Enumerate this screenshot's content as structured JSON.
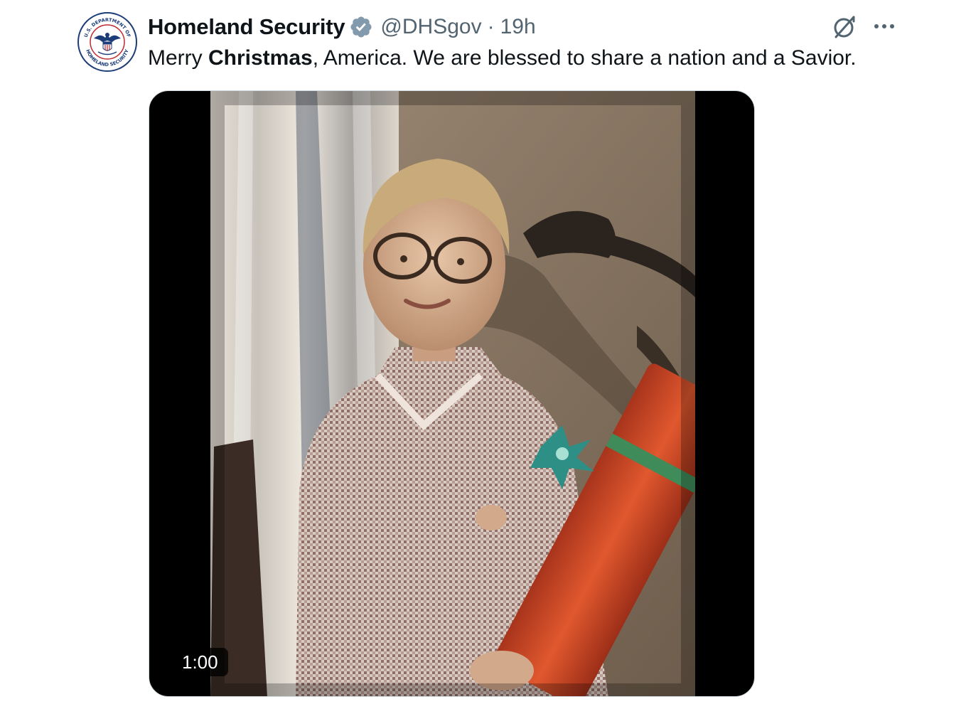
{
  "tweet": {
    "author": {
      "display_name": "Homeland Security",
      "handle": "@DHSgov",
      "verified": true,
      "avatar_icon": "dhs-seal-icon",
      "seal_text_top": "U.S. DEPARTMENT OF",
      "seal_text_bottom": "HOMELAND SECURITY"
    },
    "separator": "·",
    "timestamp": "19h",
    "text": {
      "part1": "Merry ",
      "part2_bold": "Christmas",
      "part3": ", America. We are blessed to share a nation and a Savior."
    },
    "media": {
      "type": "video",
      "duration": "1:00",
      "description_icon": "video-thumbnail"
    },
    "actions": {
      "grok_icon": "grok-icon",
      "more_icon": "more-icon"
    }
  },
  "colors": {
    "primary_text": "#0f1419",
    "secondary_text": "#536471",
    "verified_badge": "#829aab",
    "media_border": "#cfd9de"
  }
}
